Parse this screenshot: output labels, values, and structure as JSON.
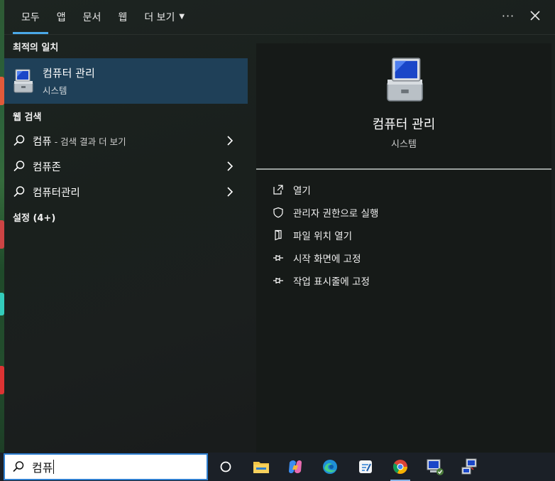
{
  "nav": {
    "tabs": [
      {
        "label": "모두",
        "active": true
      },
      {
        "label": "앱"
      },
      {
        "label": "문서"
      },
      {
        "label": "웹"
      },
      {
        "label": "더 보기"
      }
    ],
    "more_label": "···"
  },
  "best_match": {
    "section": "최적의 일치",
    "title": "컴퓨터 관리",
    "subtitle": "시스템"
  },
  "web_search": {
    "section": "웹 검색",
    "items": [
      {
        "label": "컴퓨",
        "suffix": "- 검색 결과 더 보기"
      },
      {
        "label": "컴퓨존",
        "suffix": ""
      },
      {
        "label": "컴퓨터관리",
        "suffix": ""
      }
    ]
  },
  "settings": {
    "section": "설정 (4+)"
  },
  "detail": {
    "title": "컴퓨터 관리",
    "subtitle": "시스템",
    "actions": [
      {
        "label": "열기",
        "icon": "open-icon"
      },
      {
        "label": "관리자 권한으로 실행",
        "icon": "shield-icon"
      },
      {
        "label": "파일 위치 열기",
        "icon": "file-location-icon"
      },
      {
        "label": "시작 화면에 고정",
        "icon": "pin-icon"
      },
      {
        "label": "작업 표시줄에 고정",
        "icon": "pin-icon"
      }
    ]
  },
  "taskbar": {
    "search_value": "컴퓨",
    "apps": [
      "task-view-icon",
      "file-explorer-icon",
      "copilot-icon",
      "edge-icon",
      "notepad-icon",
      "chrome-icon",
      "computer-management-icon",
      "network-icon"
    ]
  },
  "colors": {
    "accent": "#4aa8e8",
    "selected_row": "#1f4058",
    "search_border": "#2f7fd0"
  }
}
